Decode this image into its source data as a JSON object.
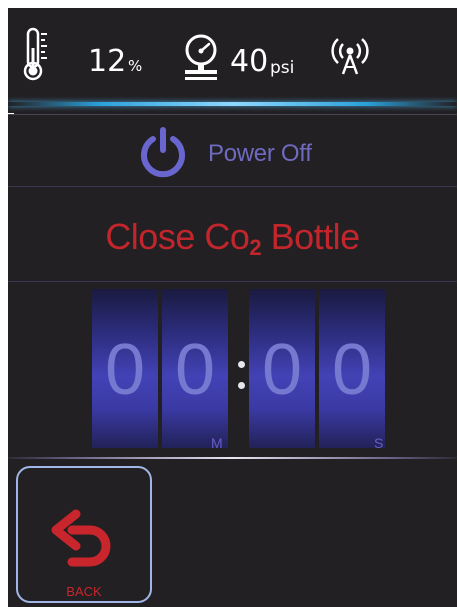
{
  "status_bar": {
    "icons": [
      "thermometer-icon",
      "pressure-gauge-icon",
      "wireless-signal-icon"
    ],
    "level_value": "12",
    "level_unit": "%",
    "pressure_value": "40",
    "pressure_unit": "psi"
  },
  "power": {
    "icon": "power-icon",
    "label": "Power Off"
  },
  "message": {
    "prefix": "Close Co",
    "subscript": "2",
    "suffix": " Bottle"
  },
  "timer": {
    "digits": [
      "0",
      "0",
      "0",
      "0"
    ],
    "minutes_label": "M",
    "seconds_label": "S"
  },
  "back_button": {
    "icon": "back-arrow-icon",
    "label": "BACK"
  },
  "colors": {
    "background": "#222022",
    "accent_red": "#c2262c",
    "power_purple": "#6e6abf",
    "digit_blue": "#4342b6",
    "glow_blue": "#2a9fd8",
    "button_border": "#9fb6e6"
  }
}
